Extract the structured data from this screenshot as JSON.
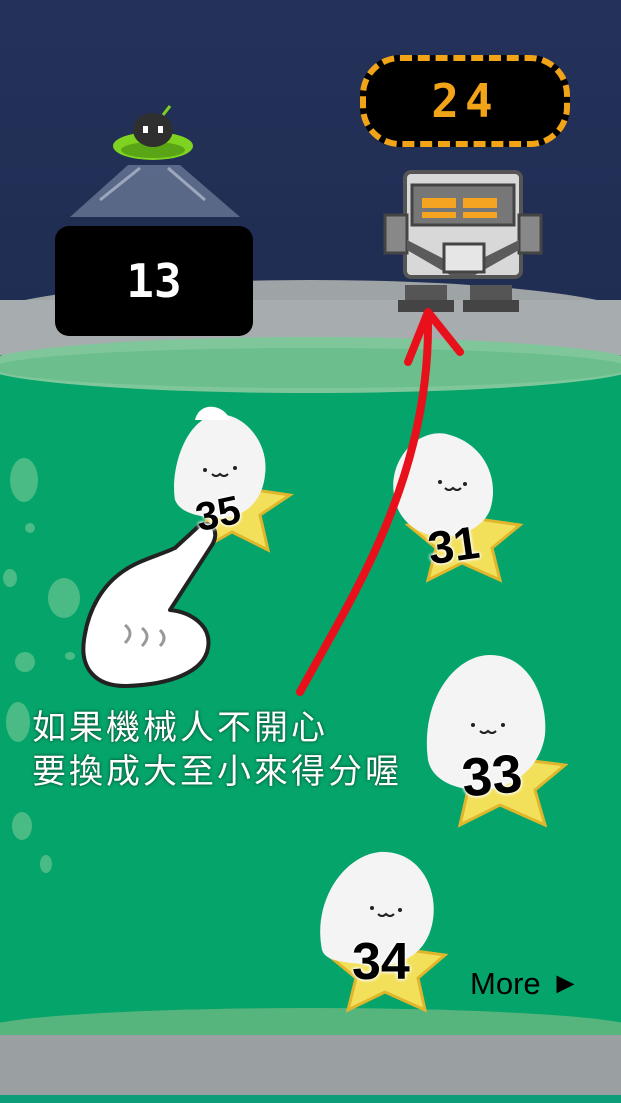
{
  "hud": {
    "left_score": "13",
    "timer": "24"
  },
  "items": [
    {
      "name": "plush-star-35",
      "number": "35"
    },
    {
      "name": "plush-star-31",
      "number": "31"
    },
    {
      "name": "plush-star-33",
      "number": "33"
    },
    {
      "name": "plush-star-34",
      "number": "34"
    }
  ],
  "instruction": {
    "line1": "如果機械人不開心",
    "line2": "要換成大至小來得分喔"
  },
  "more_label": "More",
  "more_arrow": "►",
  "colors": {
    "tank_green": "#04a46a",
    "timer_orange": "#f2a419",
    "arrow_red": "#e8101a"
  },
  "icons": [
    "ufo-icon",
    "robot-icon",
    "hand-pointer-icon",
    "curved-arrow-icon"
  ]
}
